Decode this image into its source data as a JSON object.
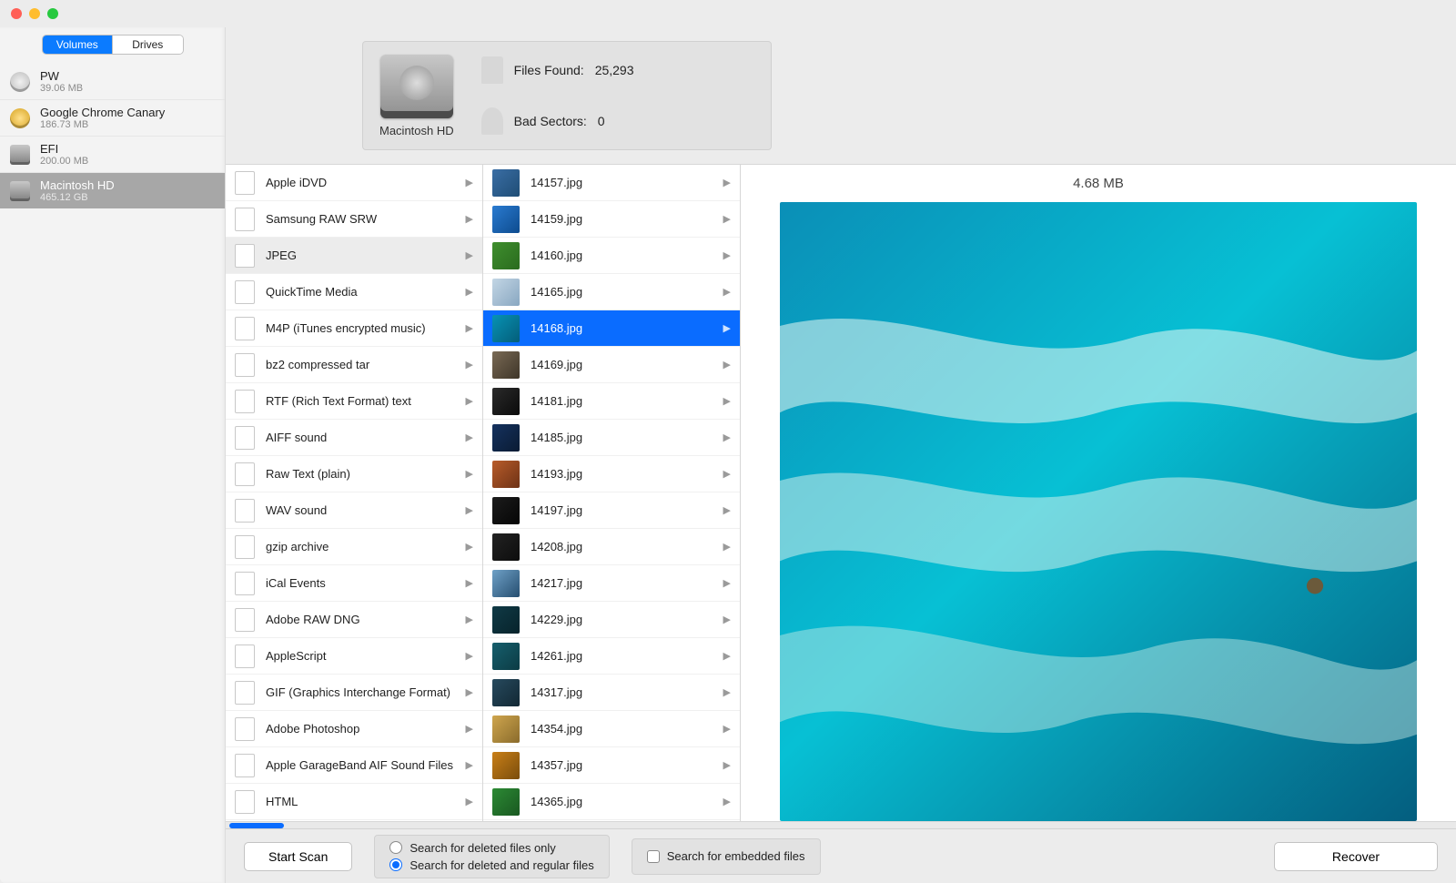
{
  "seg": {
    "volumes": "Volumes",
    "drives": "Drives"
  },
  "volumes": [
    {
      "name": "PW",
      "sub": "39.06 MB",
      "sel": false,
      "icon": "disc"
    },
    {
      "name": "Google Chrome Canary",
      "sub": "186.73 MB",
      "sel": false,
      "icon": "disc-yellow"
    },
    {
      "name": "EFI",
      "sub": "200.00 MB",
      "sel": false,
      "icon": "hd"
    },
    {
      "name": "Macintosh HD",
      "sub": "465.12 GB",
      "sel": true,
      "icon": "hd"
    }
  ],
  "info": {
    "disk_label": "Macintosh HD",
    "files_found_label": "Files Found:",
    "files_found_value": "25,293",
    "bad_sectors_label": "Bad Sectors:",
    "bad_sectors_value": "0"
  },
  "types": [
    {
      "label": "Apple iDVD",
      "sel": false
    },
    {
      "label": "Samsung RAW SRW",
      "sel": false
    },
    {
      "label": "JPEG",
      "sel": true
    },
    {
      "label": "QuickTime Media",
      "sel": false
    },
    {
      "label": "M4P (iTunes encrypted music)",
      "sel": false
    },
    {
      "label": "bz2 compressed tar",
      "sel": false
    },
    {
      "label": "RTF (Rich Text Format) text",
      "sel": false
    },
    {
      "label": "AIFF sound",
      "sel": false
    },
    {
      "label": "Raw Text (plain)",
      "sel": false
    },
    {
      "label": "WAV sound",
      "sel": false
    },
    {
      "label": "gzip archive",
      "sel": false
    },
    {
      "label": "iCal Events",
      "sel": false
    },
    {
      "label": "Adobe RAW DNG",
      "sel": false
    },
    {
      "label": "AppleScript",
      "sel": false
    },
    {
      "label": "GIF (Graphics Interchange Format)",
      "sel": false
    },
    {
      "label": "Adobe Photoshop",
      "sel": false
    },
    {
      "label": "Apple GarageBand AIF Sound Files",
      "sel": false
    },
    {
      "label": "HTML",
      "sel": false
    }
  ],
  "files": [
    {
      "name": "14157.jpg",
      "sel": false,
      "thumb": [
        "#3a6ea5",
        "#1f4d75"
      ]
    },
    {
      "name": "14159.jpg",
      "sel": false,
      "thumb": [
        "#2a7bd1",
        "#0d4b8e"
      ]
    },
    {
      "name": "14160.jpg",
      "sel": false,
      "thumb": [
        "#3f8f2e",
        "#2a6b1e"
      ]
    },
    {
      "name": "14165.jpg",
      "sel": false,
      "thumb": [
        "#c3d6e5",
        "#88a7c1"
      ]
    },
    {
      "name": "14168.jpg",
      "sel": true,
      "thumb": [
        "#0793b5",
        "#045d79"
      ]
    },
    {
      "name": "14169.jpg",
      "sel": false,
      "thumb": [
        "#7a6a55",
        "#3e3528"
      ]
    },
    {
      "name": "14181.jpg",
      "sel": false,
      "thumb": [
        "#2b2b2b",
        "#0a0a0a"
      ]
    },
    {
      "name": "14185.jpg",
      "sel": false,
      "thumb": [
        "#15325f",
        "#0a1b33"
      ]
    },
    {
      "name": "14193.jpg",
      "sel": false,
      "thumb": [
        "#b85c2a",
        "#6e3216"
      ]
    },
    {
      "name": "14197.jpg",
      "sel": false,
      "thumb": [
        "#1c1c1c",
        "#050505"
      ]
    },
    {
      "name": "14208.jpg",
      "sel": false,
      "thumb": [
        "#222222",
        "#0d0d0d"
      ]
    },
    {
      "name": "14217.jpg",
      "sel": false,
      "thumb": [
        "#6fa1c7",
        "#264e70"
      ]
    },
    {
      "name": "14229.jpg",
      "sel": false,
      "thumb": [
        "#103a46",
        "#07232b"
      ]
    },
    {
      "name": "14261.jpg",
      "sel": false,
      "thumb": [
        "#165f6d",
        "#0c3b44"
      ]
    },
    {
      "name": "14317.jpg",
      "sel": false,
      "thumb": [
        "#274a5e",
        "#122834"
      ]
    },
    {
      "name": "14354.jpg",
      "sel": false,
      "thumb": [
        "#cfa64e",
        "#8a6b2c"
      ]
    },
    {
      "name": "14357.jpg",
      "sel": false,
      "thumb": [
        "#c97f17",
        "#7a4d0c"
      ]
    },
    {
      "name": "14365.jpg",
      "sel": false,
      "thumb": [
        "#2c8a34",
        "#195821"
      ]
    }
  ],
  "preview": {
    "size": "4.68 MB"
  },
  "footer": {
    "start_scan": "Start Scan",
    "opt1": "Search for deleted files only",
    "opt2": "Search for deleted and regular files",
    "opt3": "Search for embedded files",
    "recover": "Recover"
  }
}
